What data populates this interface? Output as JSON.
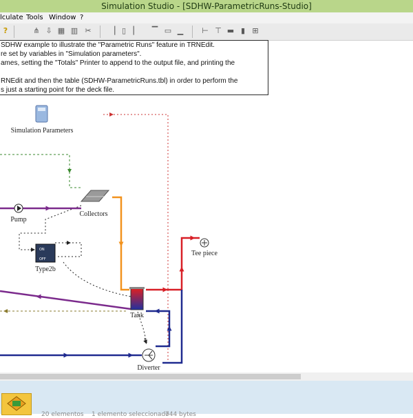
{
  "window": {
    "title": "Simulation Studio - [SDHW-ParametricRuns-Studio]"
  },
  "menu": {
    "items": [
      "lculate",
      "Tools",
      "Window",
      "?"
    ]
  },
  "description": {
    "lines": [
      "SDHW example to illustrate the \"Parametric Runs\" feature in TRNEdit.",
      "re set by variables in \"Simulation parameters\".",
      "ames, setting the \"Totals\" Printer to append to the output file, and printing the",
      "",
      "RNEdit and then the table (SDHW-ParametricRuns.tbl) in order to perform the",
      "s just a starting point for the deck file."
    ]
  },
  "components": {
    "simulation_parameters": "Simulation Parameters",
    "pump": "Pump",
    "collectors": "Collectors",
    "type2b": "Type2b",
    "tank": "Tank",
    "tee_piece": "Tee piece",
    "diverter": "Diverter"
  },
  "status": {
    "elements": "20 elementos",
    "selection": "1 elemento seleccionado",
    "size": "744 bytes"
  },
  "colors": {
    "hot": "#d81f26",
    "cold": "#1f2a8f",
    "collector_loop": "#f2921d",
    "purple": "#7b2a8c",
    "control": "#222222",
    "green_dash": "#3a8a2e",
    "olive_dash": "#8a7a2e",
    "red_dash": "#cc3333"
  }
}
